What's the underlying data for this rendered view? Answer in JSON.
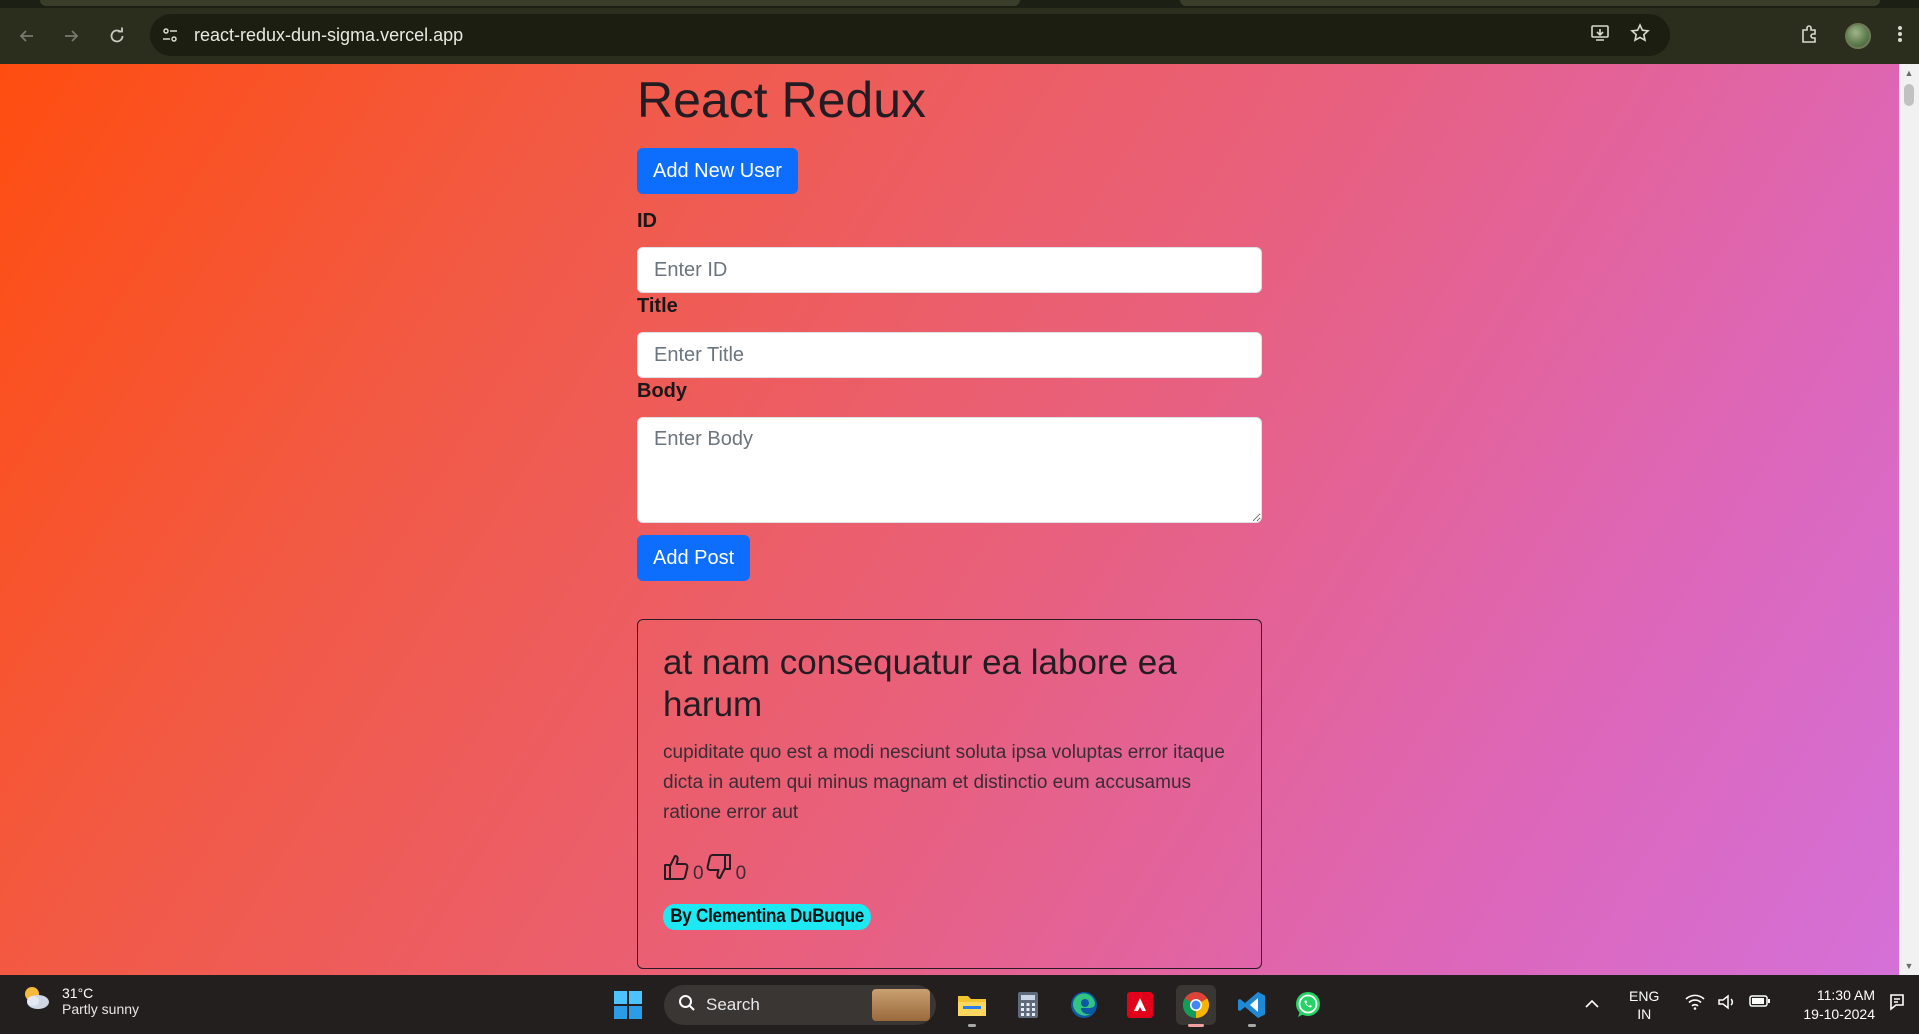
{
  "browser": {
    "url": "react-redux-dun-sigma.vercel.app"
  },
  "page": {
    "title": "React Redux",
    "add_user_label": "Add New User",
    "form": {
      "id_label": "ID",
      "id_placeholder": "Enter ID",
      "title_label": "Title",
      "title_placeholder": "Enter Title",
      "body_label": "Body",
      "body_placeholder": "Enter Body",
      "submit_label": "Add Post"
    },
    "posts": [
      {
        "title": "at nam consequatur ea labore ea harum",
        "body": "cupiditate quo est a modi nesciunt soluta ipsa voluptas error itaque dicta in autem qui minus magnam et distinctio eum accusamus ratione error aut",
        "likes": "0",
        "dislikes": "0",
        "author": "By Clementina DuBuque"
      }
    ]
  },
  "taskbar": {
    "weather_temp": "31°C",
    "weather_condition": "Partly sunny",
    "search_label": "Search",
    "language": "ENG",
    "region": "IN",
    "time": "11:30 AM",
    "date": "19-10-2024"
  },
  "colors": {
    "primary_button": "#0d6efd",
    "author_badge": "#1ee8f2",
    "gradient_start": "#ff4d10",
    "gradient_end": "#d470d8"
  }
}
